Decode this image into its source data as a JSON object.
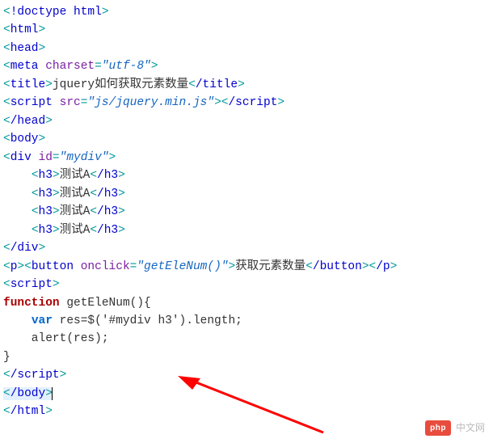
{
  "code": {
    "doctype": "!doctype html",
    "html_open": "html",
    "html_close": "/html",
    "head_open": "head",
    "head_close": "/head",
    "meta_tag": "meta",
    "meta_attr": "charset",
    "meta_val": "\"utf-8\"",
    "title_open": "title",
    "title_text": "jquery如何获取元素数量",
    "title_close": "/title",
    "script_tag": "script",
    "script_attr": "src",
    "script_val": "\"js/jquery.min.js\"",
    "script_close": "/script",
    "body_open": "body",
    "body_close": "/body",
    "div_tag": "div",
    "div_attr": "id",
    "div_val": "\"mydiv\"",
    "div_close": "/div",
    "h3_open": "h3",
    "h3_close": "/h3",
    "h3_text_1": "测试A",
    "h3_text_2": "测试A",
    "h3_text_3": "测试A",
    "h3_text_4": "测试A",
    "p_tag": "p",
    "p_close": "/p",
    "button_tag": "button",
    "button_attr": "onclick",
    "button_val": "\"getEleNum()\"",
    "button_text": "获取元素数量",
    "button_close": "/button",
    "script2_open": "script",
    "script2_close": "/script",
    "fn_kw": "function",
    "fn_name": " getEleNum(){",
    "var_kw": "var",
    "var_line": " res=$('#mydiv h3').length;",
    "alert_line": "    alert(res);",
    "brace_close": "}"
  },
  "watermark": {
    "badge": "php",
    "text": "中文网"
  }
}
